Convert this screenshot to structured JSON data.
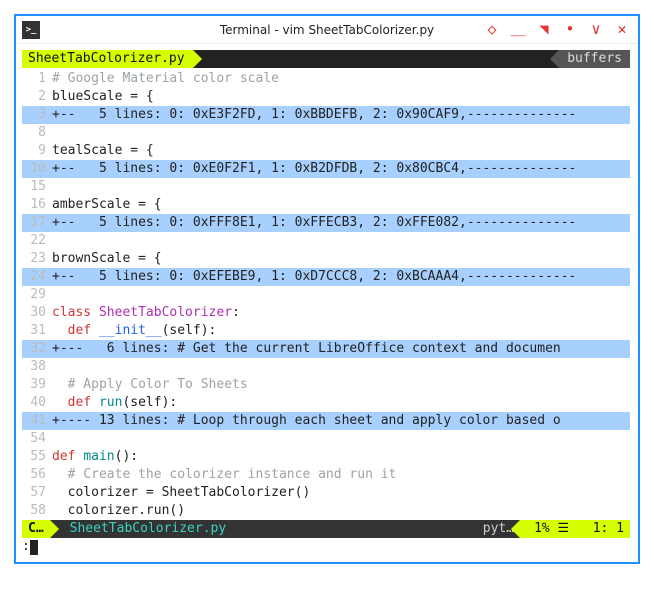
{
  "window": {
    "title": "Terminal - vim SheetTabColorizer.py"
  },
  "tabs": {
    "active": "SheetTabColorizer.py",
    "right": "buffers"
  },
  "lines": [
    {
      "n": "1",
      "fold": false,
      "segs": [
        {
          "c": "cGray",
          "t": "# Google Material color scale"
        }
      ]
    },
    {
      "n": "2",
      "fold": false,
      "segs": [
        {
          "c": "cBlack",
          "t": "blueScale = {"
        }
      ]
    },
    {
      "n": "3",
      "fold": true,
      "segs": [
        {
          "c": "cBlack",
          "t": "+--   5 lines: 0: 0xE3F2FD, 1: 0xBBDEFB, 2: 0x90CAF9,--------------"
        }
      ]
    },
    {
      "n": "8",
      "fold": false,
      "segs": []
    },
    {
      "n": "9",
      "fold": false,
      "segs": [
        {
          "c": "cBlack",
          "t": "tealScale = {"
        }
      ]
    },
    {
      "n": "10",
      "fold": true,
      "segs": [
        {
          "c": "cBlack",
          "t": "+--   5 lines: 0: 0xE0F2F1, 1: 0xB2DFDB, 2: 0x80CBC4,--------------"
        }
      ]
    },
    {
      "n": "15",
      "fold": false,
      "segs": []
    },
    {
      "n": "16",
      "fold": false,
      "segs": [
        {
          "c": "cBlack",
          "t": "amberScale = {"
        }
      ]
    },
    {
      "n": "17",
      "fold": true,
      "segs": [
        {
          "c": "cBlack",
          "t": "+--   5 lines: 0: 0xFFF8E1, 1: 0xFFECB3, 2: 0xFFE082,--------------"
        }
      ]
    },
    {
      "n": "22",
      "fold": false,
      "segs": []
    },
    {
      "n": "23",
      "fold": false,
      "segs": [
        {
          "c": "cBlack",
          "t": "brownScale = {"
        }
      ]
    },
    {
      "n": "24",
      "fold": true,
      "segs": [
        {
          "c": "cBlack",
          "t": "+--   5 lines: 0: 0xEFEBE9, 1: 0xD7CCC8, 2: 0xBCAAA4,--------------"
        }
      ]
    },
    {
      "n": "29",
      "fold": false,
      "segs": []
    },
    {
      "n": "30",
      "fold": false,
      "segs": [
        {
          "c": "cRed",
          "t": "class "
        },
        {
          "c": "cMag",
          "t": "SheetTabColorizer"
        },
        {
          "c": "cBlack",
          "t": ":"
        }
      ]
    },
    {
      "n": "31",
      "fold": false,
      "segs": [
        {
          "c": "cBlack",
          "t": "  "
        },
        {
          "c": "cRed",
          "t": "def "
        },
        {
          "c": "cBlue",
          "t": "__init__"
        },
        {
          "c": "cBlack",
          "t": "(self):"
        }
      ]
    },
    {
      "n": "32",
      "fold": true,
      "segs": [
        {
          "c": "cBlack",
          "t": "+---   6 lines: # Get the current LibreOffice context and documen"
        }
      ]
    },
    {
      "n": "38",
      "fold": false,
      "segs": []
    },
    {
      "n": "39",
      "fold": false,
      "segs": [
        {
          "c": "cBlack",
          "t": "  "
        },
        {
          "c": "cGray",
          "t": "# Apply Color To Sheets"
        }
      ]
    },
    {
      "n": "40",
      "fold": false,
      "segs": [
        {
          "c": "cBlack",
          "t": "  "
        },
        {
          "c": "cRed",
          "t": "def "
        },
        {
          "c": "cTeal",
          "t": "run"
        },
        {
          "c": "cBlack",
          "t": "(self):"
        }
      ]
    },
    {
      "n": "41",
      "fold": true,
      "segs": [
        {
          "c": "cBlack",
          "t": "+---- 13 lines: # Loop through each sheet and apply color based o"
        }
      ]
    },
    {
      "n": "54",
      "fold": false,
      "segs": []
    },
    {
      "n": "55",
      "fold": false,
      "segs": [
        {
          "c": "cRed",
          "t": "def "
        },
        {
          "c": "cTeal",
          "t": "main"
        },
        {
          "c": "cBlack",
          "t": "():"
        }
      ]
    },
    {
      "n": "56",
      "fold": false,
      "segs": [
        {
          "c": "cBlack",
          "t": "  "
        },
        {
          "c": "cGray",
          "t": "# Create the colorizer instance and run it"
        }
      ]
    },
    {
      "n": "57",
      "fold": false,
      "segs": [
        {
          "c": "cBlack",
          "t": "  colorizer = SheetTabColorizer()"
        }
      ]
    },
    {
      "n": "58",
      "fold": false,
      "segs": [
        {
          "c": "cBlack",
          "t": "  colorizer.run()"
        }
      ]
    }
  ],
  "status": {
    "mode": "C…",
    "file": "SheetTabColorizer.py",
    "filetype": "pyt…",
    "percent": "1%",
    "menu_glyph": "☰",
    "position": "1:  1"
  },
  "cmdline": {
    "prompt": ":"
  }
}
